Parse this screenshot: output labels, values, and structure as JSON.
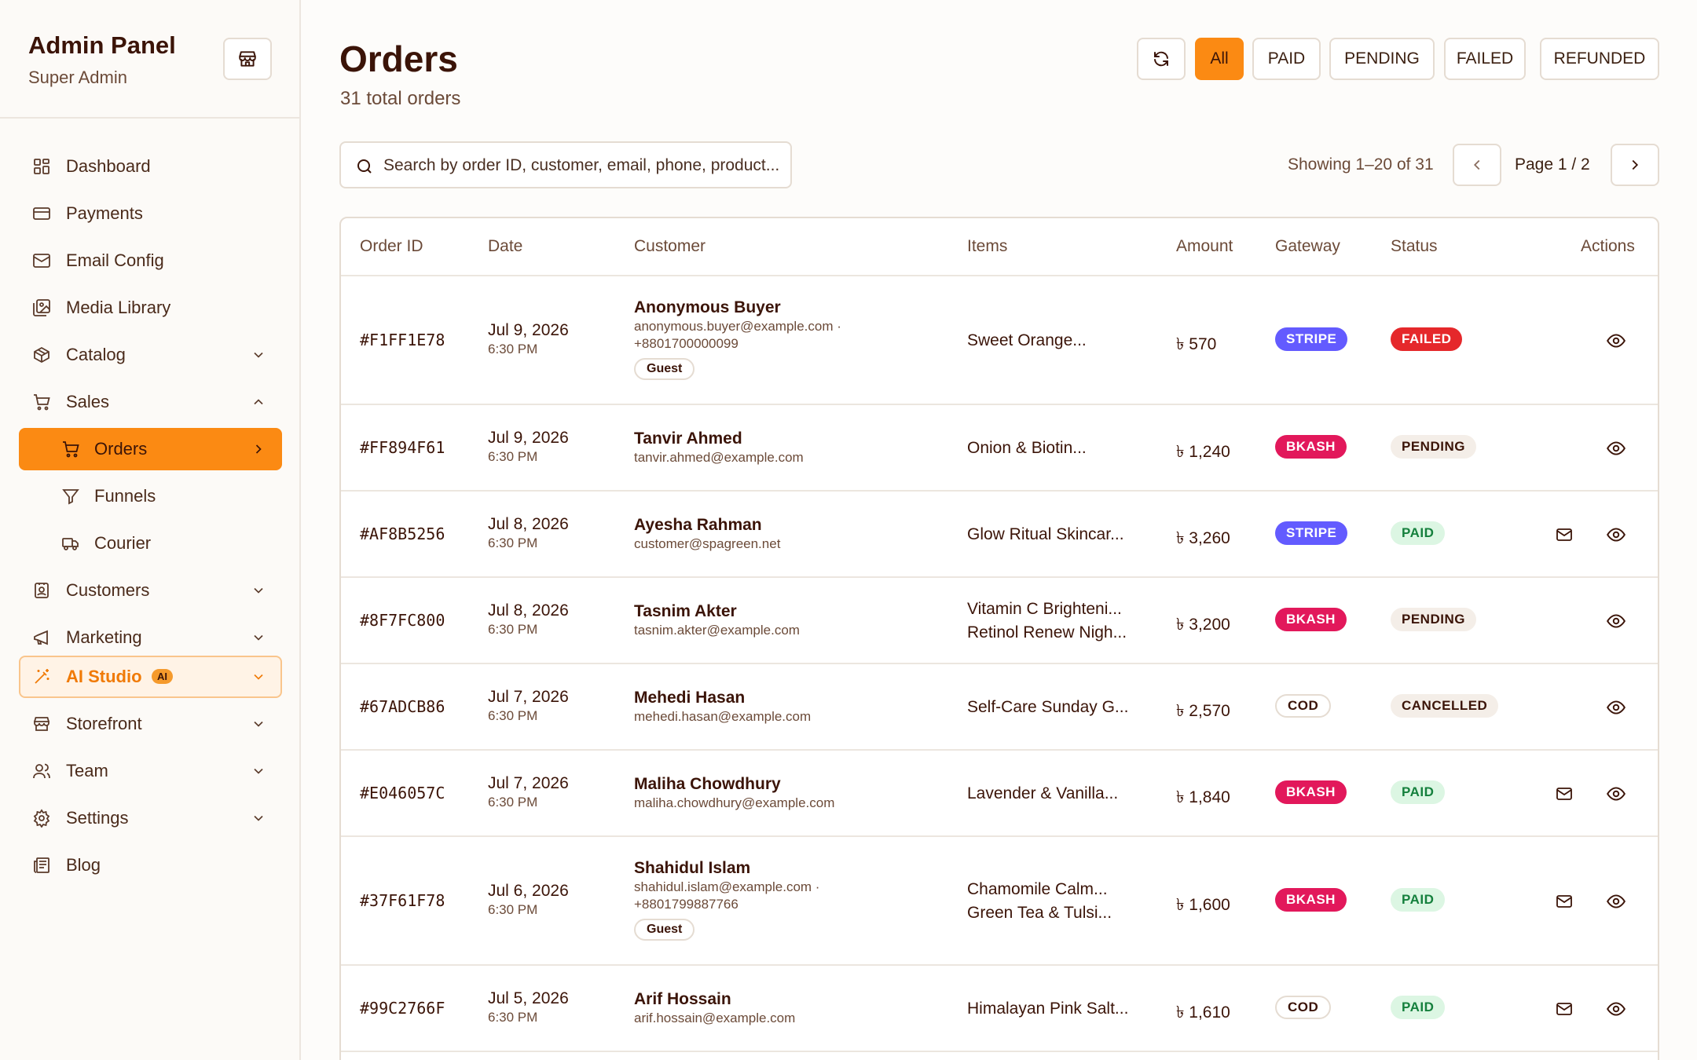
{
  "sidebar": {
    "title": "Admin Panel",
    "subtitle": "Super Admin",
    "items": [
      {
        "label": "Dashboard"
      },
      {
        "label": "Payments"
      },
      {
        "label": "Email Config"
      },
      {
        "label": "Media Library"
      },
      {
        "label": "Catalog"
      },
      {
        "label": "Sales"
      },
      {
        "label": "Orders"
      },
      {
        "label": "Funnels"
      },
      {
        "label": "Courier"
      },
      {
        "label": "Customers"
      },
      {
        "label": "Marketing"
      },
      {
        "label": "AI Studio",
        "badge": "AI"
      },
      {
        "label": "Storefront"
      },
      {
        "label": "Team"
      },
      {
        "label": "Settings"
      },
      {
        "label": "Blog"
      }
    ]
  },
  "header": {
    "title": "Orders",
    "subtitle": "31 total orders",
    "filters": [
      "All",
      "PAID",
      "PENDING",
      "FAILED",
      "REFUNDED"
    ],
    "active_filter": "All"
  },
  "search": {
    "placeholder": "Search by order ID, customer, email, phone, product..."
  },
  "pagination": {
    "showing": "Showing 1–20 of 31",
    "page": "Page 1 / 2"
  },
  "table": {
    "columns": [
      "Order ID",
      "Date",
      "Customer",
      "Items",
      "Amount",
      "Gateway",
      "Status",
      "Actions"
    ],
    "rows": [
      {
        "id": "#F1FF1E78",
        "date": "Jul 9, 2026",
        "time": "6:30 PM",
        "name": "Anonymous Buyer",
        "email": "anonymous.buyer@example.com ·",
        "phone": "+8801700000099",
        "guest": "Guest",
        "items": [
          "Sweet Orange..."
        ],
        "amount": "৳ 570",
        "gateway": "STRIPE",
        "status": "FAILED",
        "mail": false
      },
      {
        "id": "#FF894F61",
        "date": "Jul 9, 2026",
        "time": "6:30 PM",
        "name": "Tanvir Ahmed",
        "email": "tanvir.ahmed@example.com",
        "items": [
          "Onion & Biotin..."
        ],
        "amount": "৳ 1,240",
        "gateway": "BKASH",
        "status": "PENDING",
        "mail": false
      },
      {
        "id": "#AF8B5256",
        "date": "Jul 8, 2026",
        "time": "6:30 PM",
        "name": "Ayesha Rahman",
        "email": "customer@spagreen.net",
        "items": [
          "Glow Ritual Skincar..."
        ],
        "amount": "৳ 3,260",
        "gateway": "STRIPE",
        "status": "PAID",
        "mail": true
      },
      {
        "id": "#8F7FC800",
        "date": "Jul 8, 2026",
        "time": "6:30 PM",
        "name": "Tasnim Akter",
        "email": "tasnim.akter@example.com",
        "items": [
          "Vitamin C Brighteni...",
          "Retinol Renew Nigh..."
        ],
        "amount": "৳ 3,200",
        "gateway": "BKASH",
        "status": "PENDING",
        "mail": false
      },
      {
        "id": "#67ADCB86",
        "date": "Jul 7, 2026",
        "time": "6:30 PM",
        "name": "Mehedi Hasan",
        "email": "mehedi.hasan@example.com",
        "items": [
          "Self-Care Sunday G..."
        ],
        "amount": "৳ 2,570",
        "gateway": "COD",
        "status": "CANCELLED",
        "mail": false
      },
      {
        "id": "#E046057C",
        "date": "Jul 7, 2026",
        "time": "6:30 PM",
        "name": "Maliha Chowdhury",
        "email": "maliha.chowdhury@example.com",
        "items": [
          "Lavender & Vanilla..."
        ],
        "amount": "৳ 1,840",
        "gateway": "BKASH",
        "status": "PAID",
        "mail": true
      },
      {
        "id": "#37F61F78",
        "date": "Jul 6, 2026",
        "time": "6:30 PM",
        "name": "Shahidul Islam",
        "email": "shahidul.islam@example.com ·",
        "phone": "+8801799887766",
        "guest": "Guest",
        "items": [
          "Chamomile Calm...",
          "Green Tea & Tulsi..."
        ],
        "amount": "৳ 1,600",
        "gateway": "BKASH",
        "status": "PAID",
        "mail": true
      },
      {
        "id": "#99C2766F",
        "date": "Jul 5, 2026",
        "time": "6:30 PM",
        "name": "Arif Hossain",
        "email": "arif.hossain@example.com",
        "items": [
          "Himalayan Pink Salt..."
        ],
        "amount": "৳ 1,610",
        "gateway": "COD",
        "status": "PAID",
        "mail": true
      }
    ]
  },
  "colors": {
    "accent": "#fb8a13",
    "stripe": "#635bff",
    "bkash": "#e2185b",
    "failed": "#e5282b",
    "paid_bg": "#dcf6e3"
  }
}
